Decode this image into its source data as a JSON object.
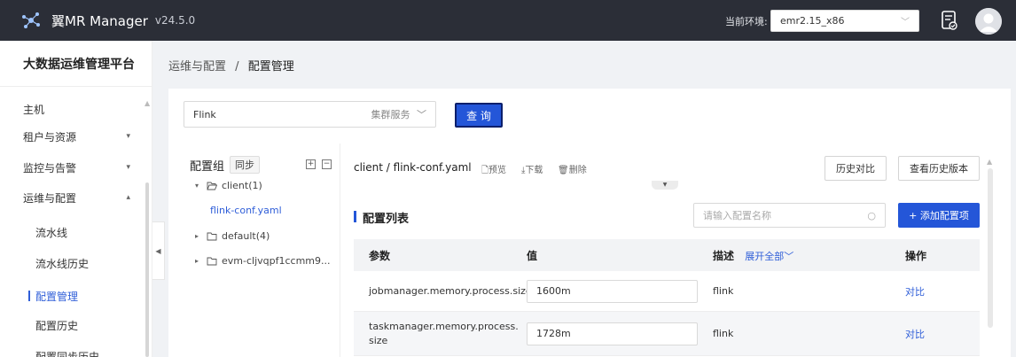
{
  "header": {
    "app_name": "翼MR Manager",
    "version": "v24.5.0",
    "env_label": "当前环境:",
    "env_value": "emr2.15_x86"
  },
  "sidebar": {
    "title": "大数据运维管理平台",
    "items": [
      {
        "label": "主机",
        "arrow": ""
      },
      {
        "label": "租户与资源",
        "arrow": "▾"
      },
      {
        "label": "监控与告警",
        "arrow": "▾"
      },
      {
        "label": "运维与配置",
        "arrow": "▴"
      },
      {
        "label": "流水线",
        "arrow": ""
      },
      {
        "label": "流水线历史",
        "arrow": ""
      },
      {
        "label": "配置管理",
        "arrow": ""
      },
      {
        "label": "配置历史",
        "arrow": ""
      },
      {
        "label": "配置同步历史",
        "arrow": ""
      }
    ]
  },
  "breadcrumb": {
    "parent": "运维与配置",
    "sep": "/",
    "current": "配置管理"
  },
  "filter": {
    "service_value": "Flink",
    "service_placeholder": "集群服务",
    "query_label": "查 询"
  },
  "tree": {
    "title": "配置组",
    "sync_label": "同步",
    "nodes": [
      {
        "caret": "▾",
        "icon": "folder-open-icon",
        "label": "client(1)"
      },
      {
        "caret": "",
        "icon": "",
        "label": "flink-conf.yaml"
      },
      {
        "caret": "▸",
        "icon": "folder-icon",
        "label": "default(4)"
      },
      {
        "caret": "▸",
        "icon": "folder-icon",
        "label": "evm-cljvqpf1ccmm9..."
      }
    ]
  },
  "file": {
    "path": "client / flink-conf.yaml",
    "preview": "预览",
    "download": "下载",
    "delete": "删除",
    "history_compare": "历史对比",
    "view_history": "查看历史版本"
  },
  "config_list": {
    "title": "配置列表",
    "search_placeholder": "请输入配置名称",
    "add_label": "+ 添加配置项",
    "columns": {
      "param": "参数",
      "value": "值",
      "desc": "描述",
      "expand_all": "展开全部",
      "action": "操作"
    },
    "rows": [
      {
        "param": "jobmanager.memory.process.size",
        "value": "1600m",
        "desc": "flink",
        "action": "对比"
      },
      {
        "param": "taskmanager.memory.process.size",
        "value": "1728m",
        "desc": "flink",
        "action": "对比"
      }
    ]
  },
  "colors": {
    "topbar": "#2b2e37",
    "primary": "#2456d8",
    "link": "#2f5ed8"
  }
}
